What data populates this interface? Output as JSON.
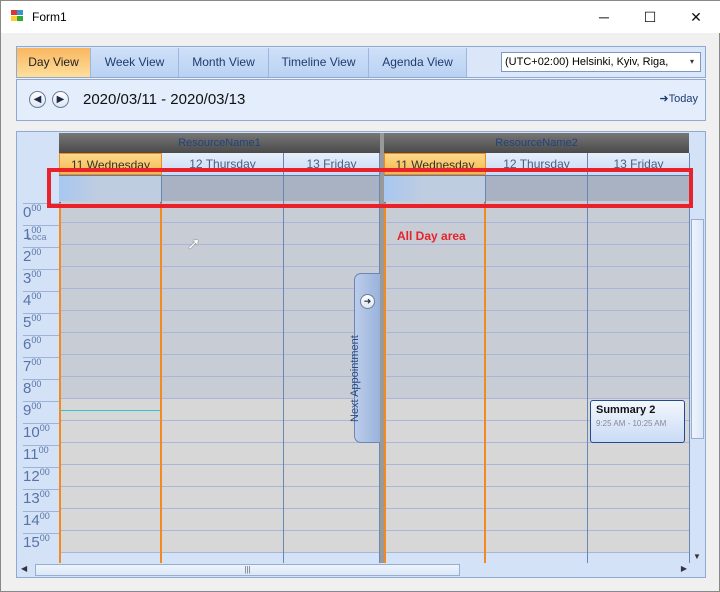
{
  "window": {
    "title": "Form1",
    "minimize": "─",
    "maximize": "☐",
    "close": "✕"
  },
  "tabs": [
    {
      "label": "Day View",
      "active": true
    },
    {
      "label": "Week View"
    },
    {
      "label": "Month View"
    },
    {
      "label": "Timeline View"
    },
    {
      "label": "Agenda View"
    }
  ],
  "timezone": {
    "value": "(UTC+02:00) Helsinki, Kyiv, Riga,",
    "arrow": "▾"
  },
  "nav": {
    "prev": "◀",
    "next": "▶",
    "date_range": "2020/03/11 - 2020/03/13",
    "today": "➜Today"
  },
  "scheduler": {
    "time_label": "Loca",
    "resources": [
      "ResourceName1",
      "ResourceName2"
    ],
    "days": [
      "11 Wednesday",
      "12 Thursday",
      "13 Friday"
    ],
    "hours": [
      "0",
      "1",
      "2",
      "3",
      "4",
      "5",
      "6",
      "7",
      "8",
      "9",
      "10",
      "11",
      "12",
      "13",
      "14",
      "15"
    ],
    "minutes": "00",
    "next_appointment": "Next Appointment",
    "appointment": {
      "summary": "Summary 2",
      "time": "9:25 AM - 10:25 AM"
    },
    "annotation": "All Day area",
    "scroll_grip": "|||"
  }
}
